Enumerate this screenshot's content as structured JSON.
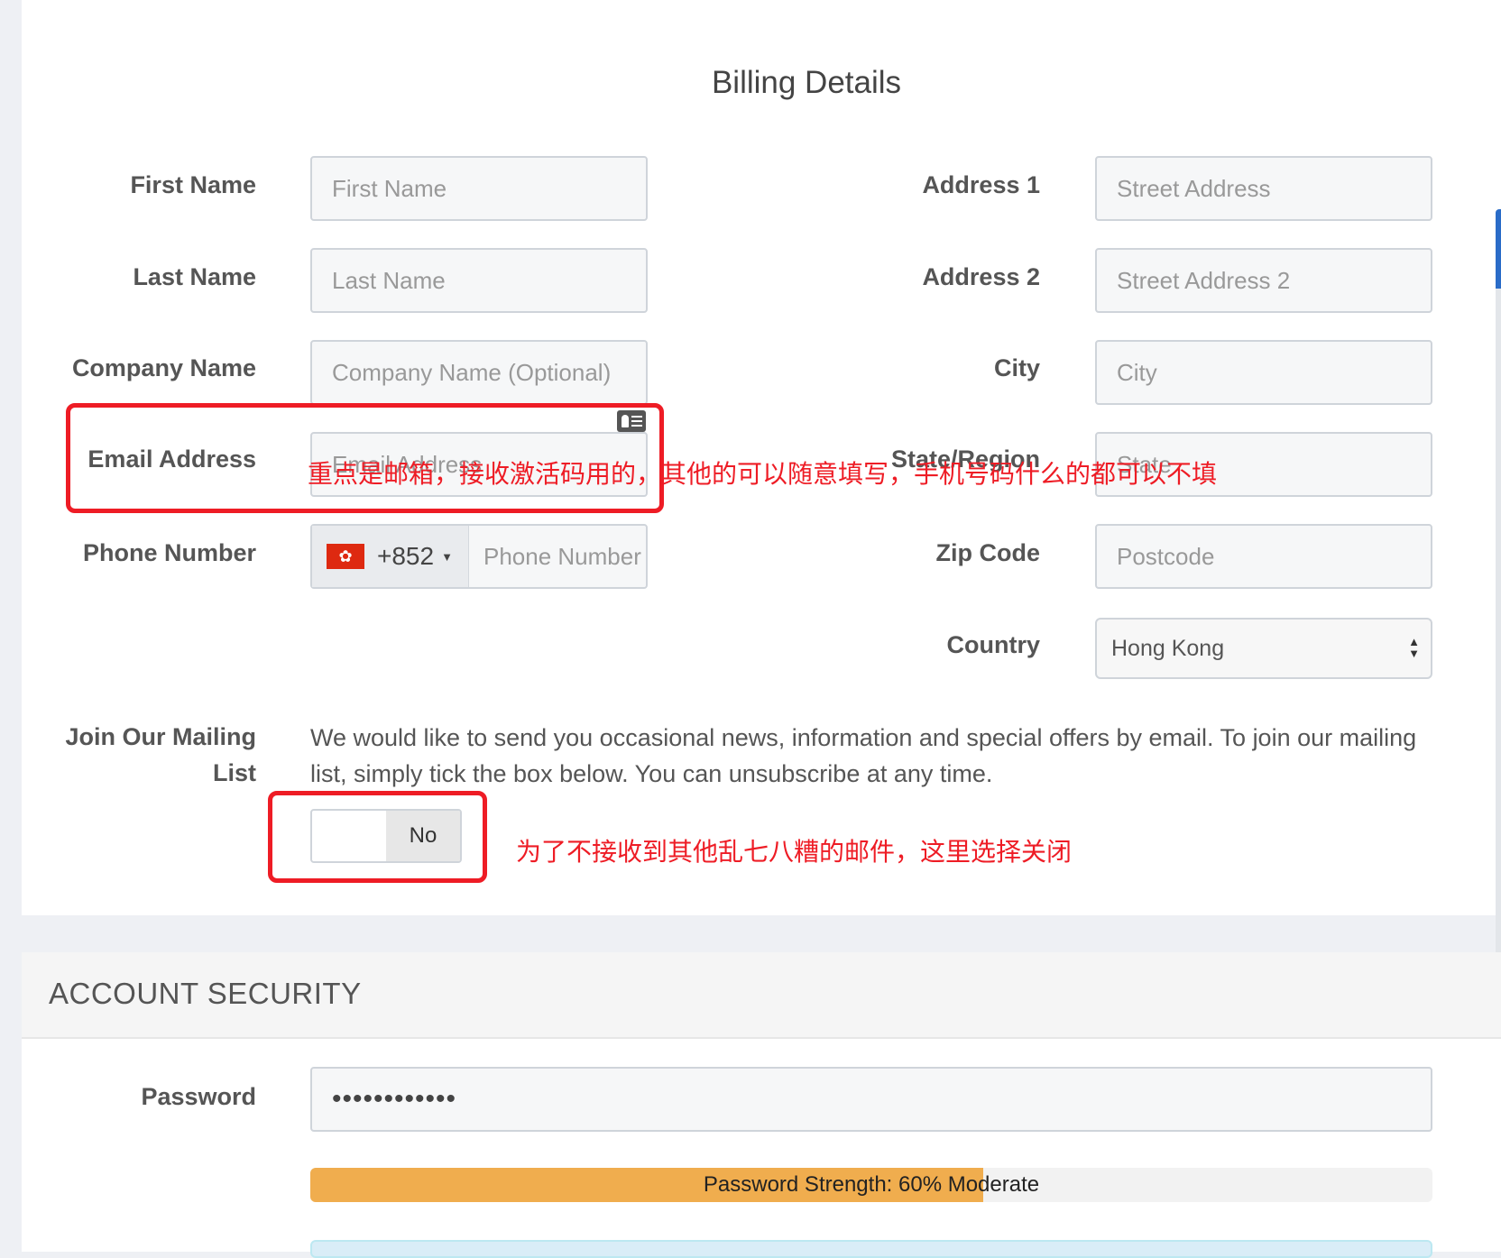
{
  "billing": {
    "title": "Billing Details",
    "fields": {
      "first_name": {
        "label": "First Name",
        "placeholder": "First Name"
      },
      "last_name": {
        "label": "Last Name",
        "placeholder": "Last Name"
      },
      "company": {
        "label": "Company Name",
        "placeholder": "Company Name (Optional)"
      },
      "email": {
        "label": "Email Address",
        "placeholder": "Email Address"
      },
      "phone": {
        "label": "Phone Number",
        "dial_code": "+852",
        "placeholder": "Phone Number",
        "flag_icon": "hong-kong-flag-icon"
      },
      "address1": {
        "label": "Address 1",
        "placeholder": "Street Address"
      },
      "address2": {
        "label": "Address 2",
        "placeholder": "Street Address 2"
      },
      "city": {
        "label": "City",
        "placeholder": "City"
      },
      "state": {
        "label": "State/Region",
        "placeholder": "State"
      },
      "zip": {
        "label": "Zip Code",
        "placeholder": "Postcode"
      },
      "country": {
        "label": "Country",
        "value": "Hong Kong"
      }
    },
    "mailing": {
      "label_line1": "Join Our Mailing",
      "label_line2": "List",
      "text": "We would like to send you occasional news, information and special offers by email. To join our mailing list, simply tick the box below. You can unsubscribe at any time.",
      "toggle_label": "No"
    }
  },
  "annotations": {
    "email_note": "重点是邮箱，接收激活码用的，其他的可以随意填写，手机号码什么的都可以不填",
    "mailing_note": "为了不接收到其他乱七八糟的邮件，这里选择关闭",
    "color": "#ee1c25"
  },
  "account_security": {
    "title": "ACCOUNT SECURITY",
    "password_label": "Password",
    "password_value": "••••••••••••",
    "strength_text": "Password Strength: 60% Moderate",
    "strength_percent": 60,
    "strength_color": "#f0ad4e"
  }
}
